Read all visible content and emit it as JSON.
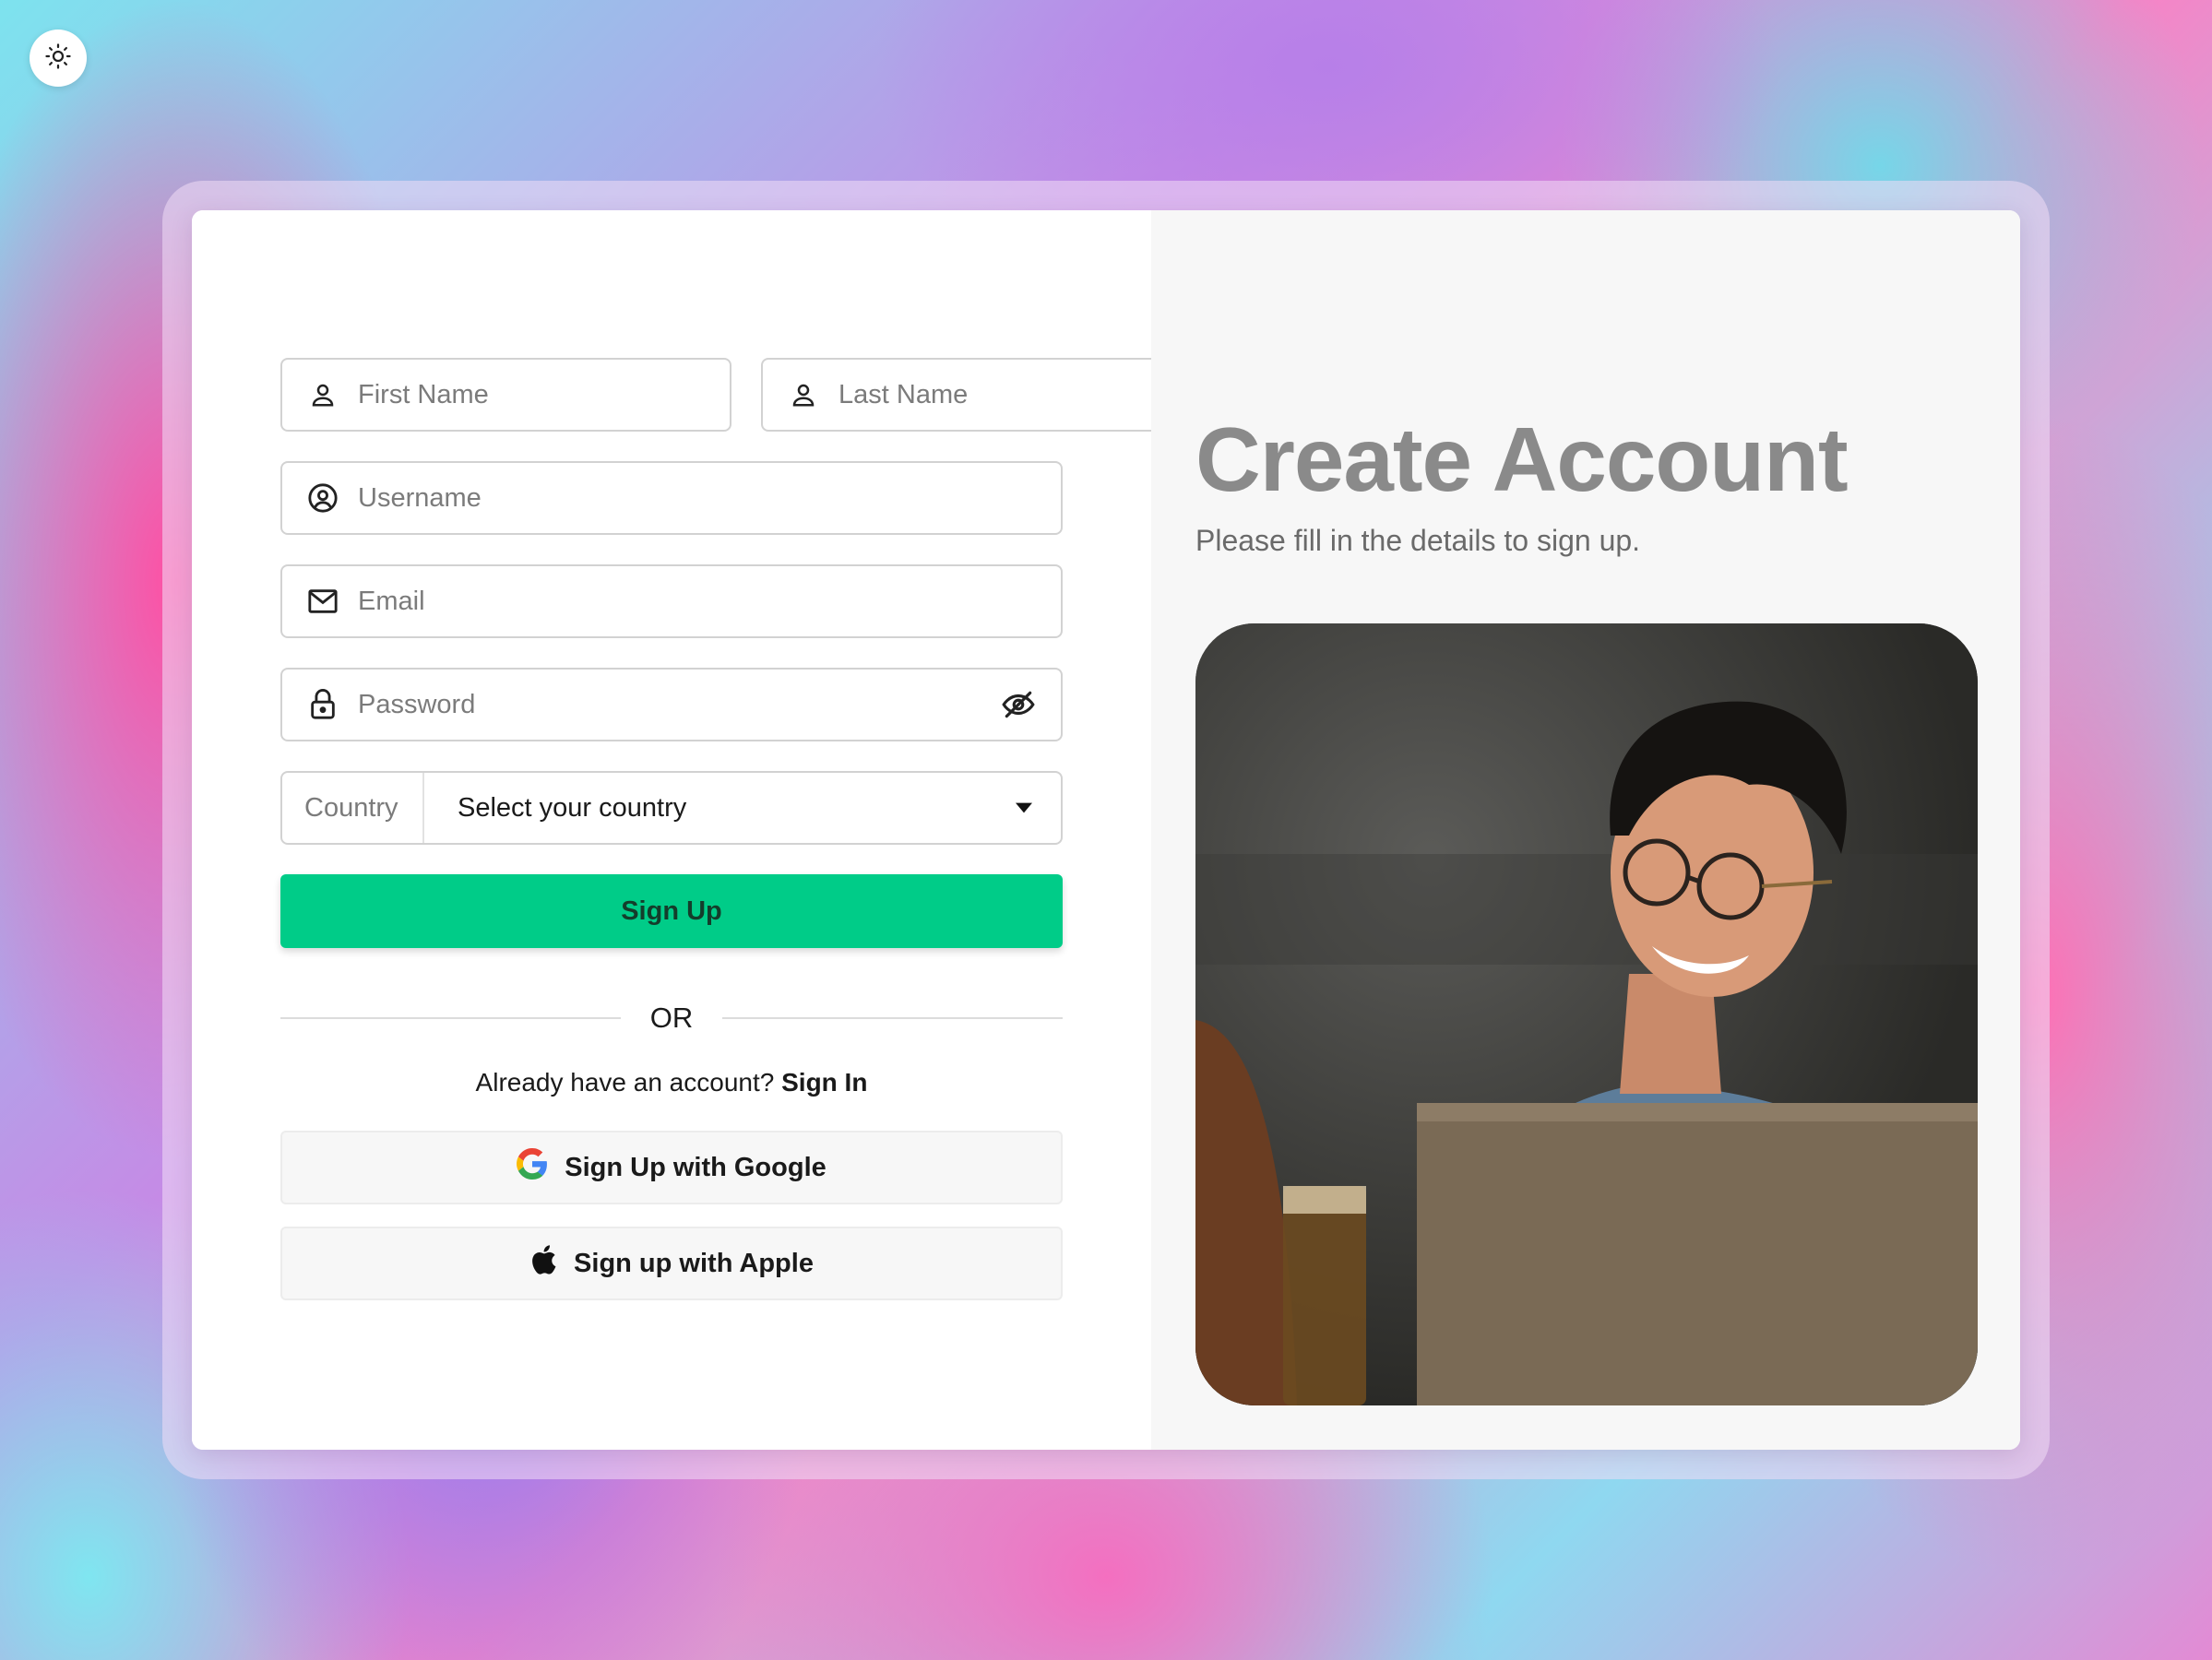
{
  "theme_toggle": {
    "icon": "sun-icon"
  },
  "form": {
    "first_name": {
      "placeholder": "First Name",
      "icon": "user-icon"
    },
    "last_name": {
      "placeholder": "Last Name",
      "icon": "user-icon"
    },
    "username": {
      "placeholder": "Username",
      "icon": "user-circle-icon"
    },
    "email": {
      "placeholder": "Email",
      "icon": "mail-icon"
    },
    "password": {
      "placeholder": "Password",
      "icon": "lock-icon",
      "toggle_icon": "eye-off-icon"
    },
    "country": {
      "label": "Country",
      "value": "Select your country",
      "icon": "caret-down-icon"
    },
    "signup_label": "Sign Up",
    "or_label": "OR",
    "already_text": "Already have an account?",
    "signin_label": "Sign In",
    "google_label": "Sign Up with Google",
    "apple_label": "Sign up with Apple"
  },
  "hero": {
    "title": "Create Account",
    "subtitle": "Please fill in the details to sign up.",
    "photo": "smiling-person-with-laptop-photo"
  },
  "colors": {
    "accent": "#00cc88",
    "title": "#8a8a8a",
    "panel_bg": "#f7f7f7"
  }
}
